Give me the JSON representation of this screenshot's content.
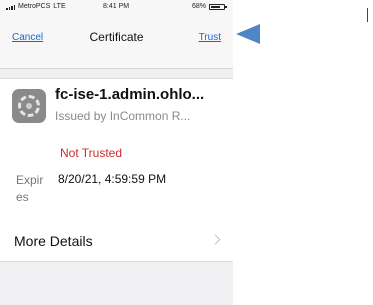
{
  "status_bar": {
    "carrier": "MetroPCS",
    "network": "LTE",
    "time": "8:41 PM",
    "battery": "68%"
  },
  "nav": {
    "cancel_label": "Cancel",
    "title": "Certificate",
    "trust_label": "Trust"
  },
  "certificate": {
    "icon": "settings-gear-icon",
    "name": "fc-ise-1.admin.ohlo...",
    "issuer": "Issued by InCommon R...",
    "trust_status": "Not Trusted",
    "expires_label": "Expires",
    "expires_value": "8/20/21, 4:59:59 PM"
  },
  "details": {
    "label": "More Details"
  },
  "colors": {
    "link": "#1a66d6",
    "not_trusted": "#d22b2b",
    "annotation_arrow": "#4f86c6"
  }
}
